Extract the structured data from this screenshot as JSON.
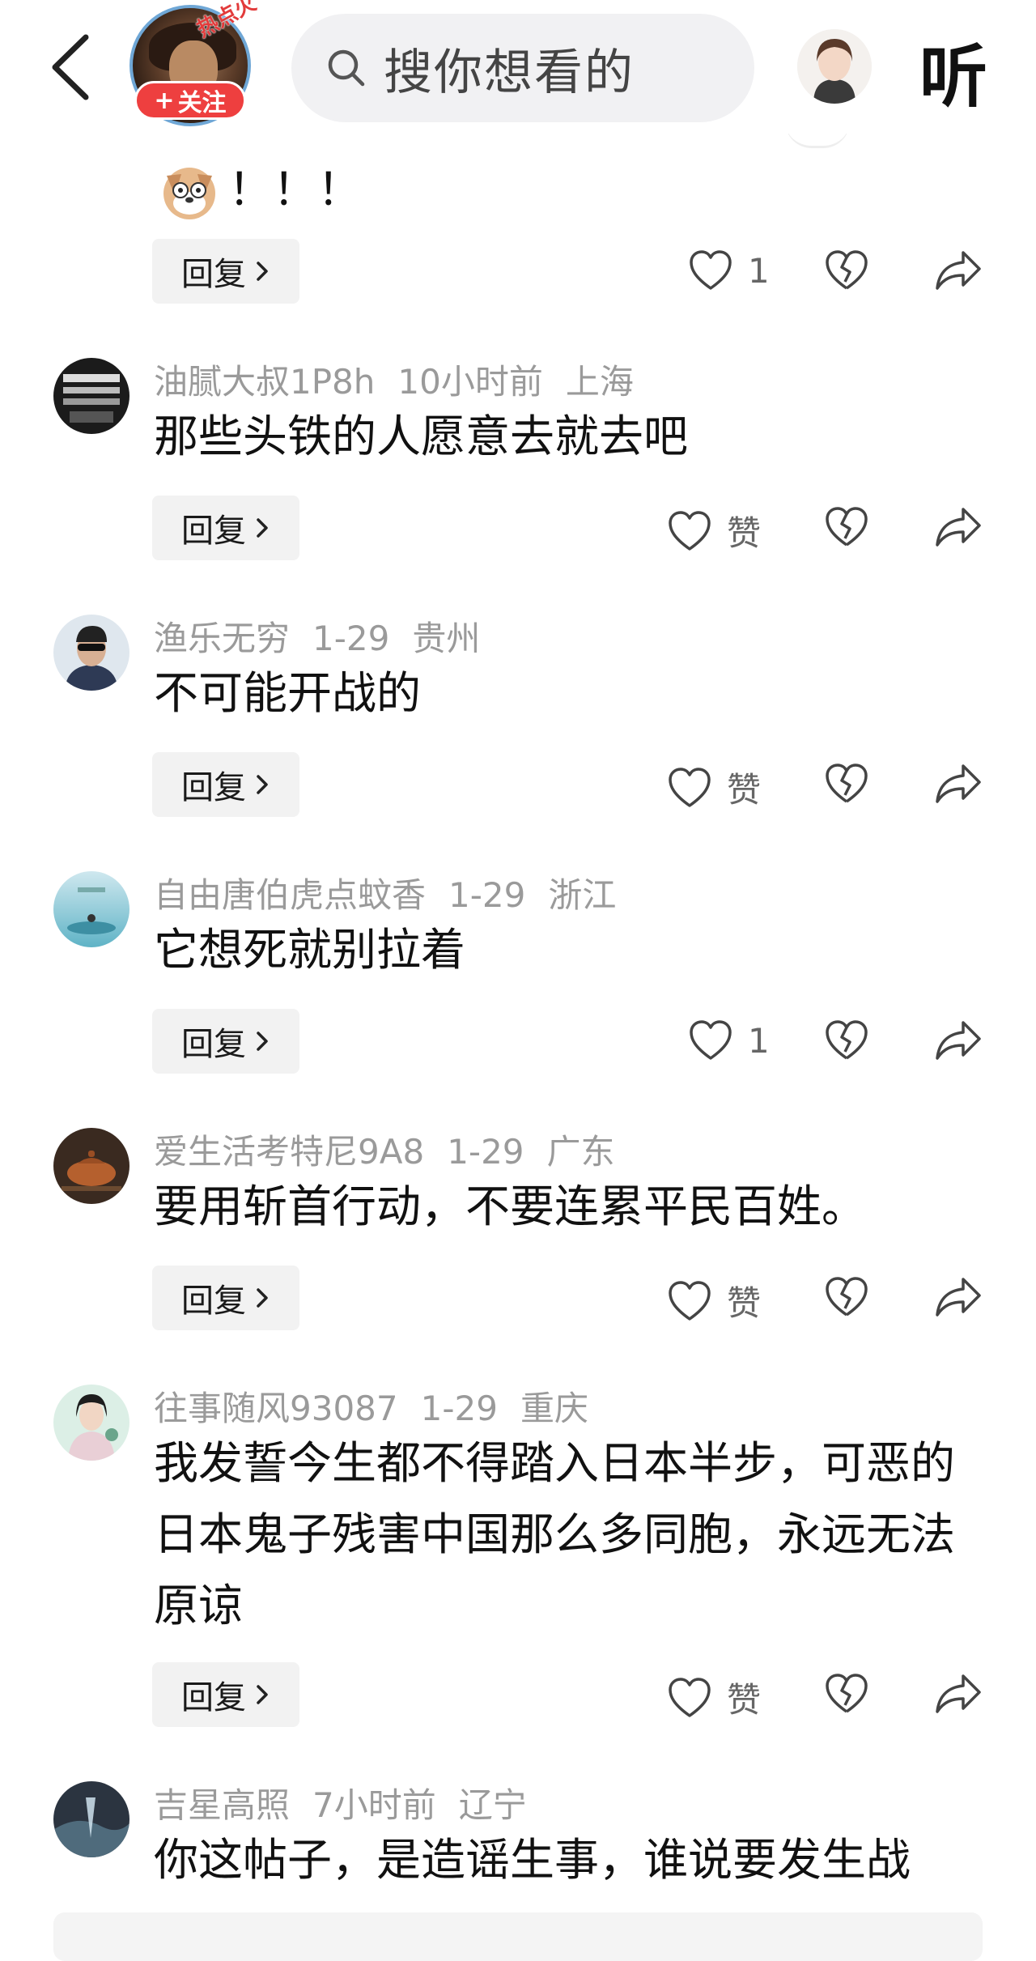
{
  "header": {
    "hot_badge": "热点火",
    "follow_label": "关注",
    "follow_plus": "+",
    "search_placeholder": "搜你想看的",
    "listen_label": "听"
  },
  "first_comment": {
    "text": "！！！",
    "reply_label": "回复",
    "like_count": "1"
  },
  "comments": [
    {
      "username": "油腻大叔1P8h",
      "time": "10小时前",
      "location": "上海",
      "text": "那些头铁的人愿意去就去吧",
      "reply_label": "回复",
      "like": "赞"
    },
    {
      "username": "渔乐无穷",
      "time": "1-29",
      "location": "贵州",
      "text": "不可能开战的",
      "reply_label": "回复",
      "like": "赞"
    },
    {
      "username": "自由唐伯虎点蚊香",
      "time": "1-29",
      "location": "浙江",
      "text": "它想死就别拉着",
      "reply_label": "回复",
      "like": "1"
    },
    {
      "username": "爱生活考特尼9A8",
      "time": "1-29",
      "location": "广东",
      "text": "要用斩首行动，不要连累平民百姓。",
      "reply_label": "回复",
      "like": "赞"
    },
    {
      "username": "往事随风93087",
      "time": "1-29",
      "location": "重庆",
      "text": "我发誓今生都不得踏入日本半步，可恶的日本鬼子残害中国那么多同胞，永远无法原谅",
      "reply_label": "回复",
      "like": "赞"
    },
    {
      "username": "吉星高照",
      "time": "7小时前",
      "location": "辽宁",
      "text": "你这帖子，是造谣生事，谁说要发生战"
    }
  ],
  "colors": {
    "accent": "#ee3f3f",
    "meta": "#9a9a9a",
    "reply_bg": "#f2f2f2"
  }
}
